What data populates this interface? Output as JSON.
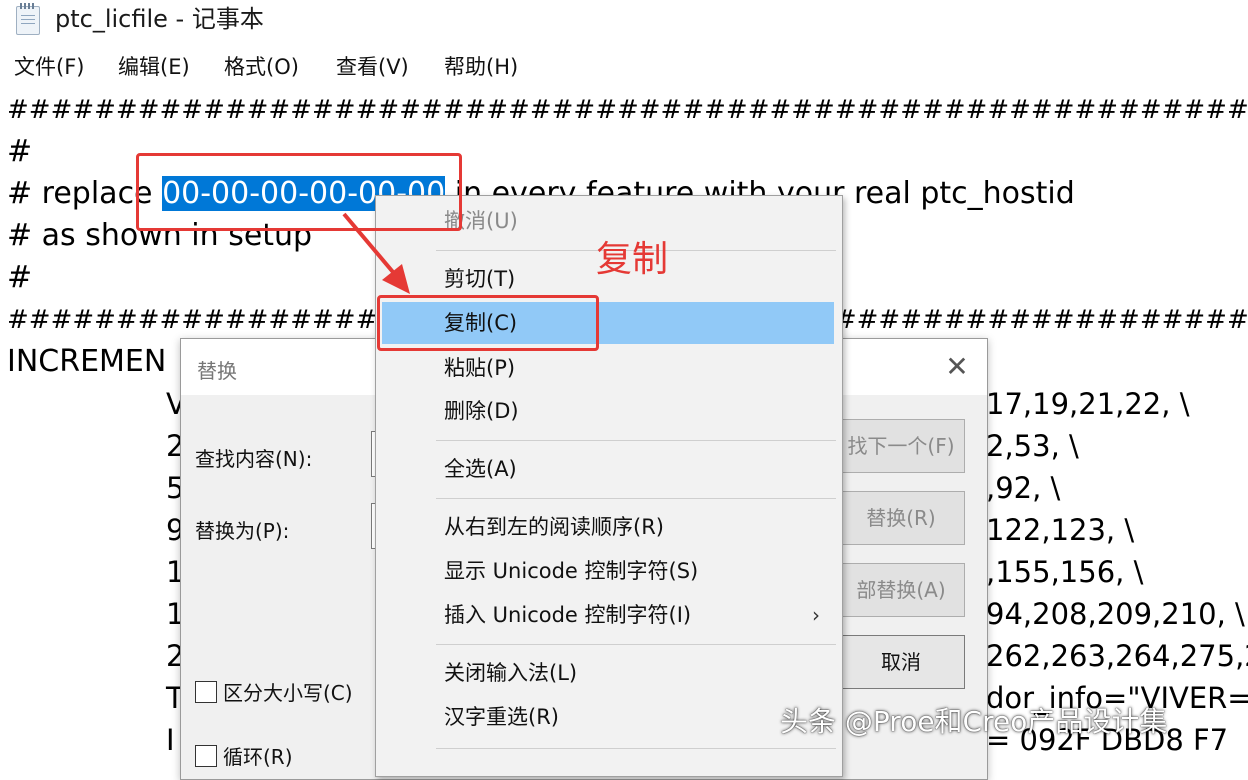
{
  "window": {
    "title": "ptc_licfile - 记事本"
  },
  "menubar": [
    "文件(F)",
    "编辑(E)",
    "格式(O)",
    "查看(V)",
    "帮助(H)"
  ],
  "editor": {
    "hash_line": "########################################################################################",
    "lines": [
      "#",
      "# as shown in setup",
      "#"
    ],
    "replace_prefix": "# replace ",
    "selected_text": "00-00-00-00-00-00",
    "replace_suffix": " in every feature with your real ptc_hostid",
    "increment_line": "INCREMEN",
    "right_fragments": [
      "17,19,21,22, \\",
      "2,53, \\",
      ",92, \\",
      "122,123, \\",
      ",155,156, \\",
      "94,208,209,210, \\",
      "262,263,264,275,27",
      "dor_info=\"VIVER=",
      "= 092F DBD8 F7"
    ],
    "left_fragments": [
      "V",
      "2",
      "5",
      "9",
      "1",
      "1",
      "2",
      "T",
      "I"
    ]
  },
  "replace_dialog": {
    "title": "替换",
    "find_label": "查找内容(N):",
    "replace_label": "替换为(P):",
    "find_next_button": "找下一个(F)",
    "replace_button": "替换(R)",
    "replace_all_button": "部替换(A)",
    "cancel_button": "取消",
    "match_case_label": "区分大小写(C)",
    "wrap_label": "循环(R)"
  },
  "context_menu": {
    "undo": "撤消(U)",
    "cut": "剪切(T)",
    "copy": "复制(C)",
    "paste": "粘贴(P)",
    "delete": "删除(D)",
    "select_all": "全选(A)",
    "rtl": "从右到左的阅读顺序(R)",
    "show_unicode": "显示 Unicode 控制字符(S)",
    "insert_unicode": "插入 Unicode 控制字符(I)",
    "close_ime": "关闭输入法(L)",
    "reconvert": "汉字重选(R)"
  },
  "annotation": {
    "text": "复制"
  },
  "watermark": "头条 @Proe和Creo产品设计集",
  "colors": {
    "selection": "#0078d7",
    "menu_highlight": "#91c9f7",
    "annotation_red": "#e53935"
  }
}
